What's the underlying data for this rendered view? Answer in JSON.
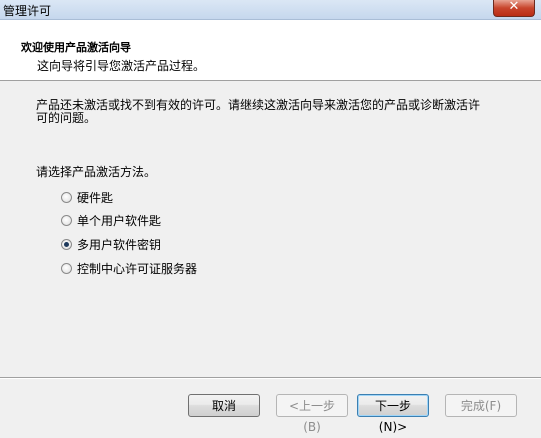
{
  "window": {
    "title": "管理许可",
    "close_glyph": "✕"
  },
  "header": {
    "title": "欢迎使用产品激活向导",
    "subtitle": "这向导将引导您激活产品过程。"
  },
  "main": {
    "description": "产品还未激活或找不到有效的许可。请继续这激活向导来激活您的产品或诊断激活许可的问题。",
    "prompt": "请选择产品激活方法。",
    "options": [
      {
        "label": "硬件匙",
        "checked": false
      },
      {
        "label": "单个用户软件匙",
        "checked": false
      },
      {
        "label": "多用户软件密钥",
        "checked": true
      },
      {
        "label": "控制中心许可证服务器",
        "checked": false
      }
    ]
  },
  "footer": {
    "cancel_label": "取消",
    "back_label": "<上一步(B)",
    "next_label": "下一步(N)>",
    "finish_label": "完成(F)"
  }
}
